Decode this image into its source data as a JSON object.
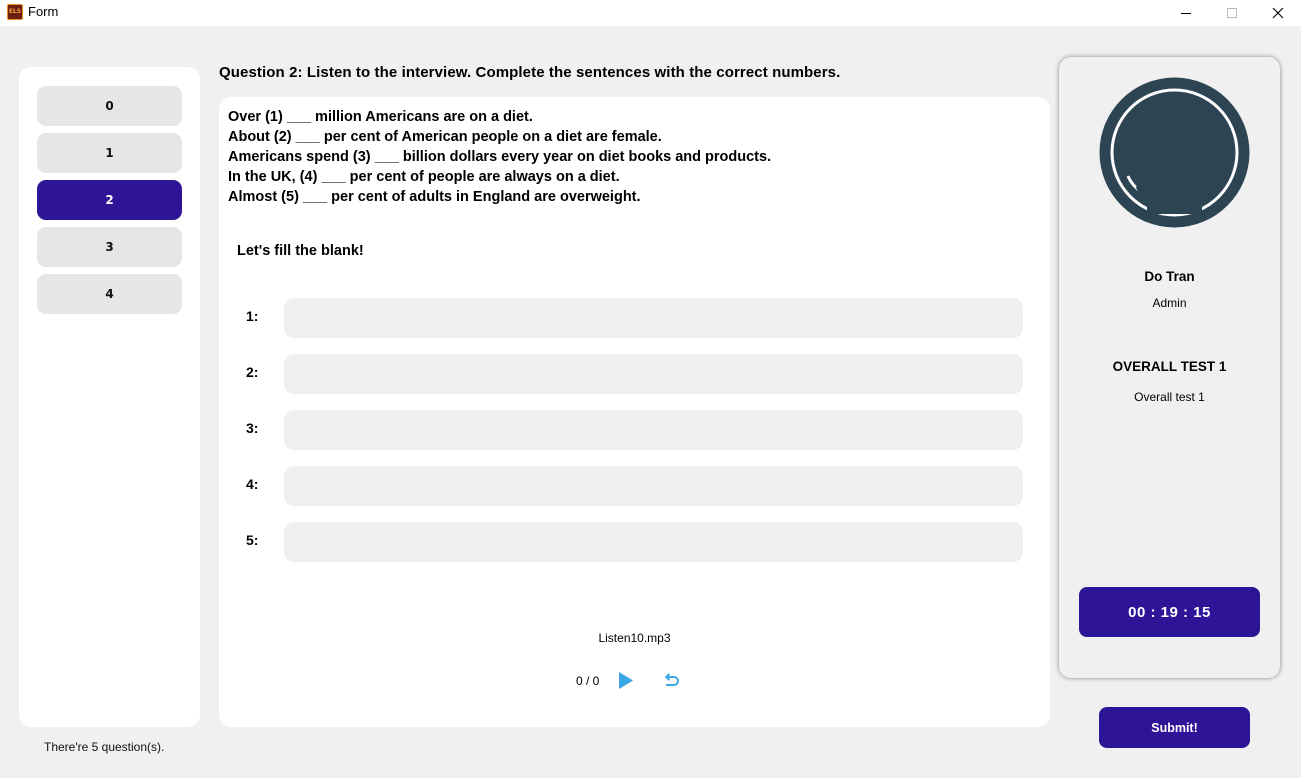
{
  "window": {
    "title": "Form",
    "icon_text": "ELS"
  },
  "nav": {
    "items": [
      {
        "label": "0",
        "active": false
      },
      {
        "label": "1",
        "active": false
      },
      {
        "label": "2",
        "active": true
      },
      {
        "label": "3",
        "active": false
      },
      {
        "label": "4",
        "active": false
      }
    ],
    "question_count": "There're 5 question(s)."
  },
  "question": {
    "title": "Question 2: Listen to the interview. Complete the sentences with the correct numbers.",
    "sentences": [
      "Over (1) ___ million Americans are on a diet.",
      "About (2) ___ per cent of American people on a diet are female.",
      "Americans spend (3) ___ billion dollars every year on diet books and products.",
      "In the UK, (4) ___ per cent of people are always on a diet.",
      "Almost (5) ___ per cent of adults in England are overweight."
    ],
    "fill_heading": "Let's fill the blank!",
    "answers": [
      {
        "label": "1:",
        "value": ""
      },
      {
        "label": "2:",
        "value": ""
      },
      {
        "label": "3:",
        "value": ""
      },
      {
        "label": "4:",
        "value": ""
      },
      {
        "label": "5:",
        "value": ""
      }
    ]
  },
  "audio": {
    "file_name": "Listen10.mp3",
    "time": "0 / 0"
  },
  "profile": {
    "name": "Do Tran",
    "role": "Admin",
    "avatar_icon": "github-octocat-icon"
  },
  "test": {
    "title": "OVERALL TEST 1",
    "subtitle": "Overall test 1",
    "timer": "00 : 19 : 15"
  },
  "actions": {
    "submit_label": "Submit!"
  },
  "colors": {
    "accent": "#2e1497",
    "play": "#3ba7e6",
    "avatar": "#2d4453"
  }
}
